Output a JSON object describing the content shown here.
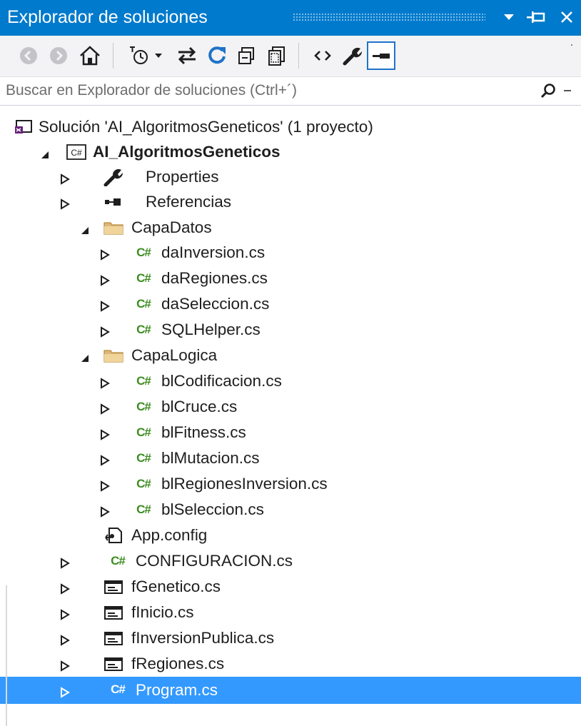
{
  "window": {
    "title": "Explorador de soluciones",
    "accent_color": "#007acc",
    "title_buttons": [
      "dropdown-icon",
      "pin-icon",
      "close-icon"
    ]
  },
  "toolbar": {
    "buttons": [
      "back-icon",
      "forward-icon",
      "home-icon",
      "pending-changes-filter-icon",
      "dropdown-icon",
      "sync-icon",
      "refresh-icon",
      "collapse-all-icon",
      "show-all-files-icon",
      "view-code-icon",
      "properties-icon",
      "preview-icon"
    ]
  },
  "search": {
    "placeholder": "Buscar en Explorador de soluciones (Ctrl+´)",
    "value": ""
  },
  "tree": {
    "solution": "Solución 'AI_AlgoritmosGeneticos'  (1 proyecto)",
    "project": "AI_AlgoritmosGeneticos",
    "properties": "Properties",
    "references": "Referencias",
    "capa_datos": "CapaDatos",
    "capa_datos_files": [
      "daInversion.cs",
      "daRegiones.cs",
      "daSeleccion.cs",
      "SQLHelper.cs"
    ],
    "capa_logica": "CapaLogica",
    "capa_logica_files": [
      "blCodificacion.cs",
      "blCruce.cs",
      "blFitness.cs",
      "blMutacion.cs",
      "blRegionesInversion.cs",
      "blSeleccion.cs"
    ],
    "app_config": "App.config",
    "configuracion": "CONFIGURACION.cs",
    "forms": [
      "fGenetico.cs",
      "fInicio.cs",
      "fInversionPublica.cs",
      "fRegiones.cs"
    ],
    "program": "Program.cs",
    "selected_color": "#3399ff"
  }
}
